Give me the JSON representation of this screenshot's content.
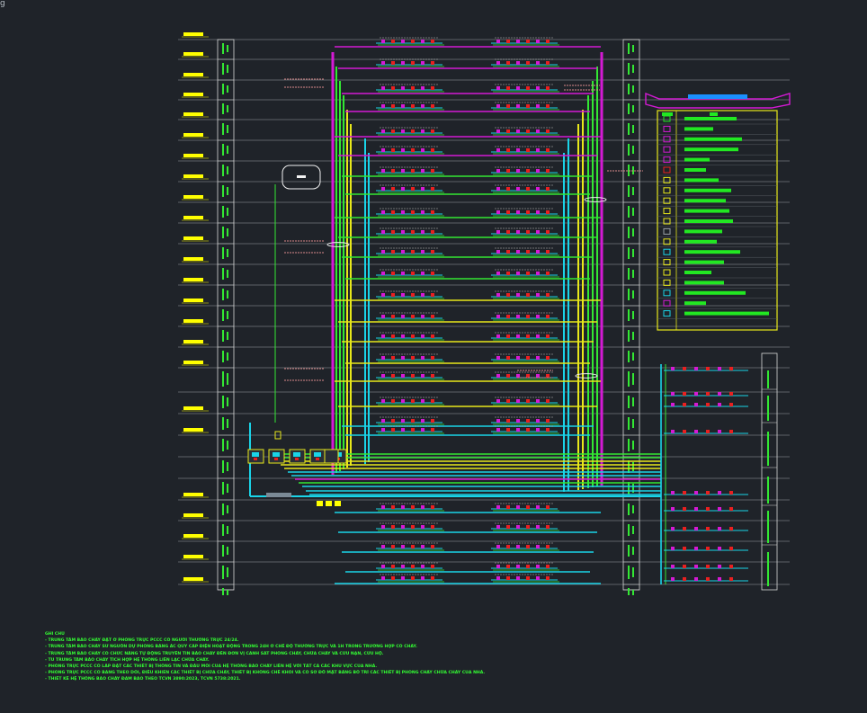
{
  "corner_glyph": "g",
  "notes": {
    "heading": "GHI CHÚ",
    "lines": [
      "- TRUNG TÂM BÁO CHÁY ĐẶT Ở PHÒNG TRỰC PCCC CÓ NGƯỜI THƯỜNG TRỰC 24/24.",
      "- TRUNG TÂM BÁO CHÁY SỬ NGUỒN DỰ PHÒNG BẰNG ẮC QUY CẤP ĐIỆN HOẠT ĐỘNG TRONG 24H Ở CHẾ ĐỘ THƯỜNG TRỰC VÀ 1H TRONG TRƯỜNG HỢP CÓ CHÁY.",
      "- TRUNG TÂM BÁO CHÁY CÓ CHỨC NĂNG TỰ ĐỘNG TRUYỀN TIN BÁO CHÁY ĐẾN ĐƠN VỊ CẢNH SÁT PHÒNG CHÁY, CHỮA CHÁY VÀ CỨU NẠN, CỨU HỘ.",
      "- TỦ TRUNG TÂM BÁO CHÁY TÍCH HỢP HỆ THỐNG LIÊN LẠC CHỮA CHÁY.",
      "- PHÒNG TRỰC PCCC CÓ LẮP ĐẶT CÁC THIẾT BỊ THÔNG TIN VÀ ĐẦU MỐI CỦA HỆ THỐNG BÁO CHÁY LIÊN HỆ VỚI TẤT CẢ CÁC KHU VỰC CỦA NHÀ.",
      "- PHÒNG TRỰC PCCC CÓ BẢNG THEO DÕI, ĐIỀU KHIỂN CÁC THIẾT BỊ CHỮA CHÁY, THIẾT BỊ KHỐNG CHẾ KHÓI VÀ CÓ SƠ ĐỒ MẶT BẰNG BỐ TRÍ CÁC THIẾT BỊ PHÒNG CHÁY CHỮA CHÁY CỦA NHÀ.",
      "- THIẾT KẾ HỆ THỐNG BÁO CHÁY ĐẢM BẢO THEO TCVN 3890:2023, TCVN 5738:2021."
    ]
  },
  "colors": {
    "background": "#1f2329",
    "grid_line": "#9aa0a6",
    "frame": "#d8d8d8",
    "magenta": "#d41ad4",
    "green": "#33e833",
    "yellow": "#e8e81a",
    "cyan": "#1ad4e8",
    "red": "#e82020",
    "white": "#f2f2f2",
    "legend_border": "#e8e81a",
    "legend_fill": "#22e822",
    "legend_title_blue": "#1a90ff",
    "label_yellow": "#ffff00"
  },
  "legend": {
    "row_count": 20,
    "icon_colors": [
      "#22e822",
      "#d41ad4",
      "#d41ad4",
      "#d41ad4",
      "#d41ad4",
      "#e82020",
      "#e8e81a",
      "#e8e81a",
      "#e8e81a",
      "#e8e81a",
      "#e8e81a",
      "#9aa0a6",
      "#e8e81a",
      "#1ad4e8",
      "#e8e81a",
      "#e8e81a",
      "#e8e81a",
      "#1ad4e8",
      "#d41ad4",
      "#1ad4e8"
    ]
  },
  "diagram": {
    "floor_rows_main": 27,
    "floor_rows_annex": 11,
    "panel_count": 5
  }
}
